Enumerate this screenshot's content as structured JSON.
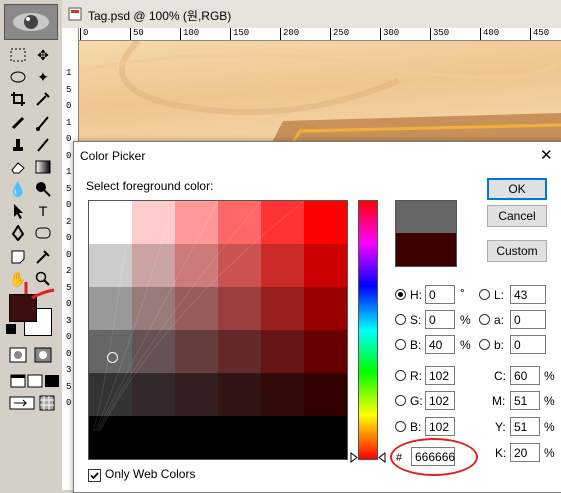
{
  "document": {
    "title": "Tag.psd @ 100% (원,RGB)",
    "ruler_top_ticks": [
      "0",
      "50",
      "100",
      "150",
      "200",
      "250",
      "300",
      "350",
      "400",
      "450"
    ],
    "ruler_left_ticks": [
      "1",
      "5",
      "0",
      "1",
      "0",
      "0",
      "1",
      "5",
      "0",
      "2",
      "0",
      "0",
      "2",
      "5",
      "0",
      "3",
      "0",
      "0",
      "3",
      "5",
      "0"
    ]
  },
  "tools": {
    "foreground_color": "#3d0c0c",
    "background_color": "#ffffff",
    "accent_arrow_color": "#e02020"
  },
  "dialog": {
    "title": "Color Picker",
    "close_glyph": "✕",
    "prompt": "Select foreground color:",
    "ok_label": "OK",
    "cancel_label": "Cancel",
    "custom_label": "Custom",
    "new_color": "#666666",
    "current_color": "#3d0000",
    "hsb": {
      "h_label": "H:",
      "h_value": "0",
      "h_unit": "°",
      "s_label": "S:",
      "s_value": "0",
      "s_unit": "%",
      "b_label": "B:",
      "b_value": "40",
      "b_unit": "%"
    },
    "lab": {
      "l_label": "L:",
      "l_value": "43",
      "a_label": "a:",
      "a_value": "0",
      "b_label": "b:",
      "b_value": "0"
    },
    "rgb": {
      "r_label": "R:",
      "r_value": "102",
      "g_label": "G:",
      "g_value": "102",
      "b_label": "B:",
      "b_value": "102"
    },
    "cmyk": {
      "c_label": "C:",
      "c_value": "60",
      "c_unit": "%",
      "m_label": "M:",
      "m_value": "51",
      "m_unit": "%",
      "y_label": "Y:",
      "y_value": "51",
      "y_unit": "%",
      "k_label": "K:",
      "k_value": "20",
      "k_unit": "%"
    },
    "hex_label": "#",
    "hex_value": "666666",
    "highlight_color": "#e02020",
    "only_web_colors_label": "Only Web Colors",
    "only_web_colors_checked": true
  }
}
